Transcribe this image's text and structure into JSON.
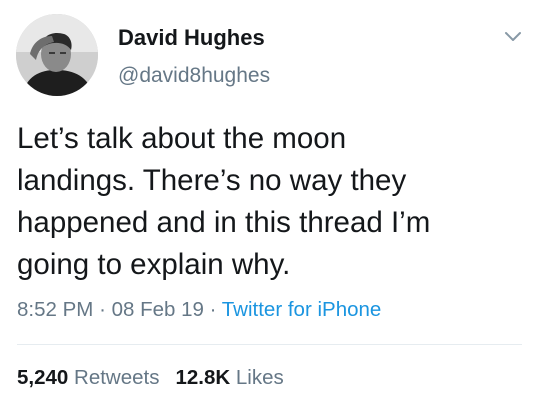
{
  "user": {
    "name": "David Hughes",
    "handle": "@david8hughes"
  },
  "tweet": {
    "text": "Let’s talk about the moon\nlandings. There’s no way they\nhappened and in this thread I’m\ngoing to explain why.",
    "time": "8:52 PM",
    "date": "08 Feb 19",
    "separator": "·",
    "source": "Twitter for iPhone"
  },
  "stats": {
    "retweets_count": "5,240",
    "retweets_label": "Retweets",
    "likes_count": "12.8K",
    "likes_label": "Likes"
  },
  "icons": {
    "menu": "chevron-down-icon",
    "avatar": "avatar"
  },
  "colors": {
    "text_primary": "#14171a",
    "text_secondary": "#657786",
    "link": "#1b95e0",
    "divider": "#e6ecf0"
  }
}
